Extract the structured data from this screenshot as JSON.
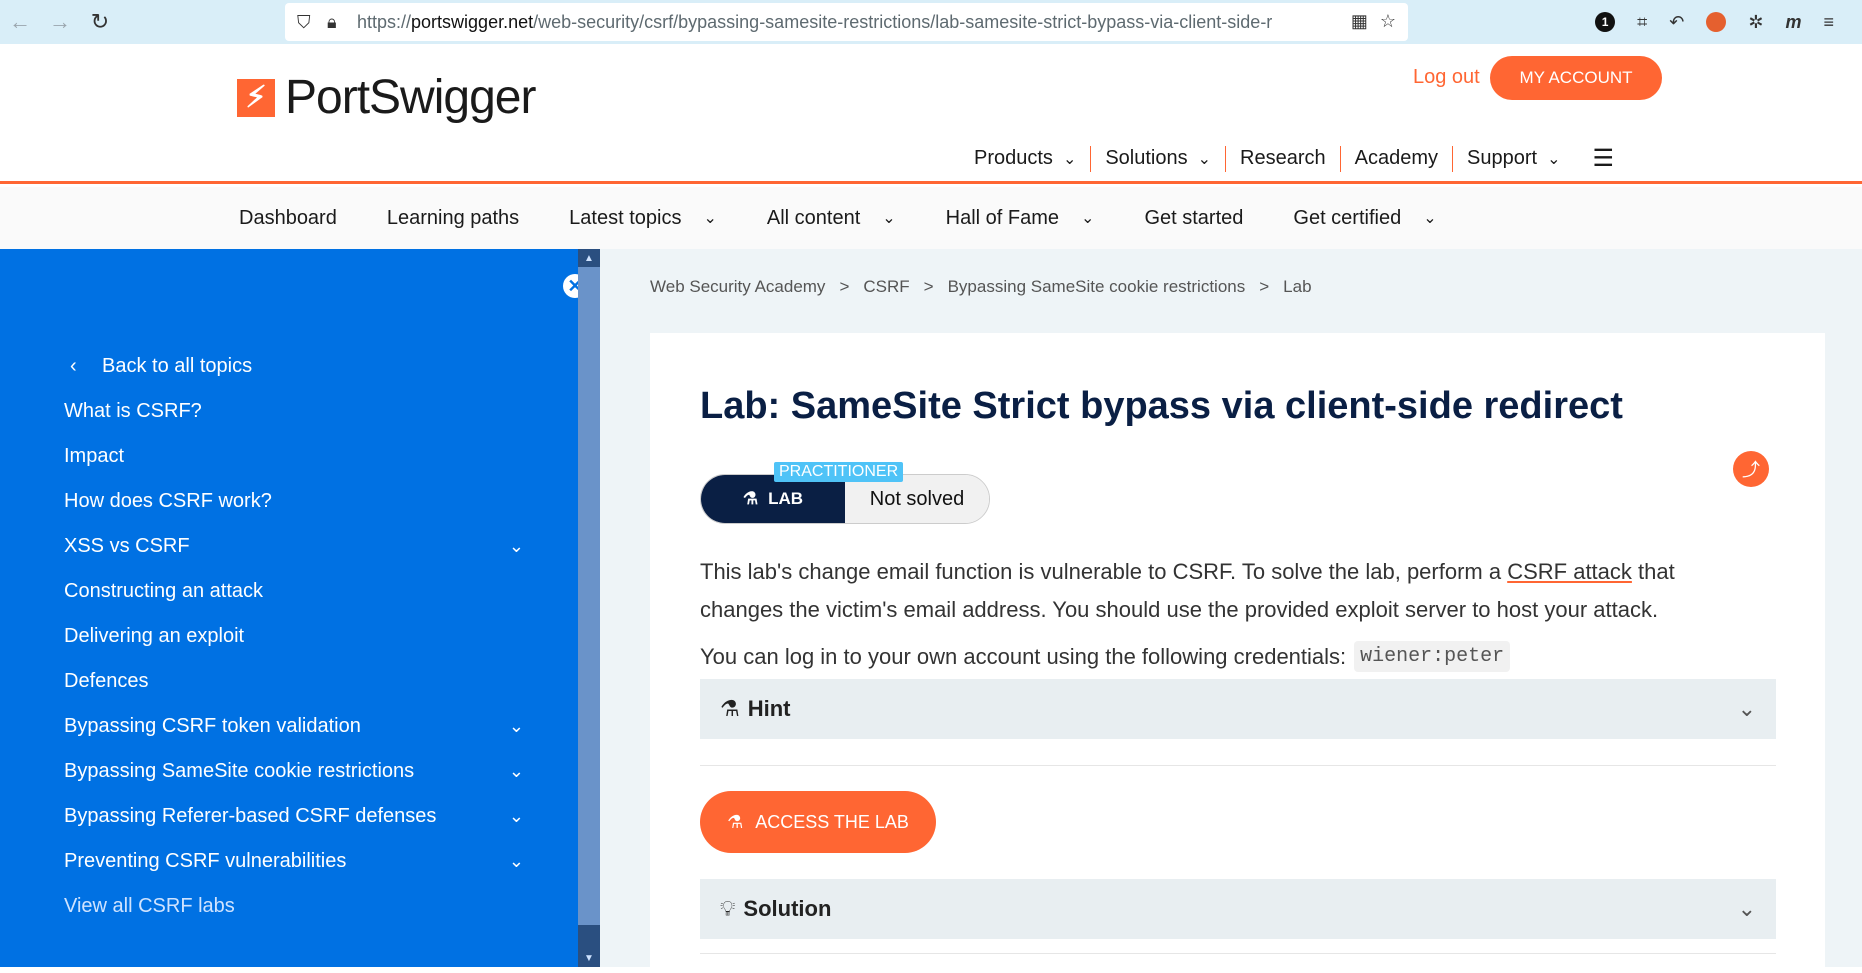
{
  "browser": {
    "url_scheme": "https://",
    "url_host": "portswigger.net",
    "url_path": "/web-security/csrf/bypassing-samesite-restrictions/lab-samesite-strict-bypass-via-client-side-r",
    "ext_badge": "1"
  },
  "header": {
    "brand": "PortSwigger",
    "logout_label": "Log out",
    "account_label": "MY ACCOUNT",
    "top_nav": [
      "Products",
      "Solutions",
      "Research",
      "Academy",
      "Support"
    ]
  },
  "sub_nav": [
    "Dashboard",
    "Learning paths",
    "Latest topics",
    "All content",
    "Hall of Fame",
    "Get started",
    "Get certified"
  ],
  "sidebar": {
    "items": [
      {
        "label": "Back to all topics"
      },
      {
        "label": "What is CSRF?"
      },
      {
        "label": "Impact"
      },
      {
        "label": "How does CSRF work?"
      },
      {
        "label": "XSS vs CSRF"
      },
      {
        "label": "Constructing an attack"
      },
      {
        "label": "Delivering an exploit"
      },
      {
        "label": "Defences"
      },
      {
        "label": "Bypassing CSRF token validation"
      },
      {
        "label": "Bypassing SameSite cookie restrictions"
      },
      {
        "label": "Bypassing Referer-based CSRF defenses"
      },
      {
        "label": "Preventing CSRF vulnerabilities"
      },
      {
        "label": "View all CSRF labs"
      }
    ]
  },
  "breadcrumb": [
    "Web Security Academy",
    "CSRF",
    "Bypassing SameSite cookie restrictions",
    "Lab"
  ],
  "breadcrumb_sep": ">",
  "lab": {
    "title": "Lab: SameSite Strict bypass via client-side redirect",
    "level": "PRACTITIONER",
    "lab_label": "LAB",
    "status": "Not solved",
    "desc_part1": "This lab's change email function is vulnerable to CSRF. To solve the lab, perform a ",
    "desc_link": "CSRF attack",
    "desc_part2": " that changes the victim's email address. You should use the provided exploit server to host your attack.",
    "creds_text": "You can log in to your own account using the following credentials:",
    "creds_code": "wiener:peter",
    "hint_label": "Hint",
    "access_label": "ACCESS THE LAB",
    "solution_label": "Solution"
  }
}
